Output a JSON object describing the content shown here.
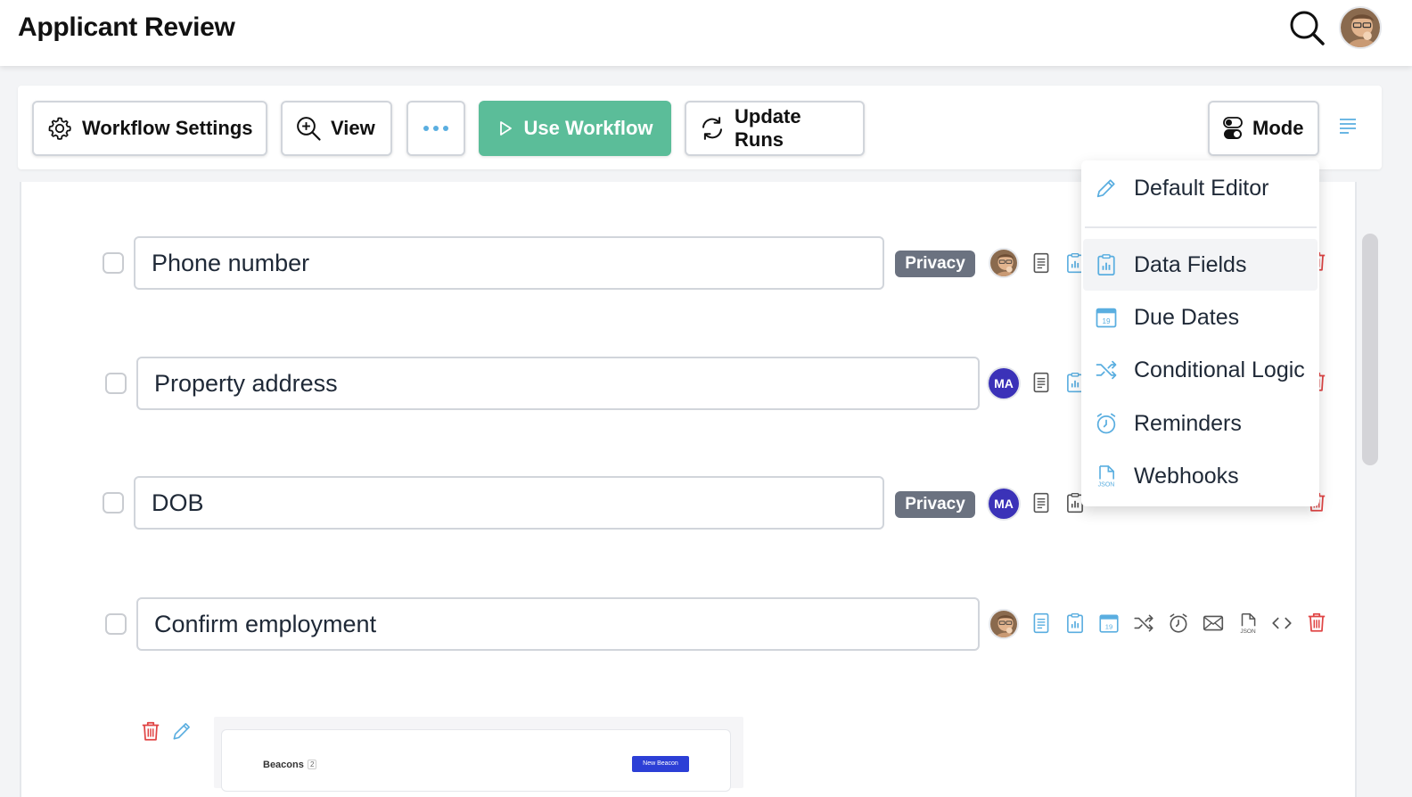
{
  "app": {
    "title": "Applicant Review"
  },
  "header": {
    "search_icon": "search-icon",
    "avatar": "user-avatar"
  },
  "toolbar": {
    "workflow_settings": "Workflow Settings",
    "view": "View",
    "use_workflow": "Use Workflow",
    "update_runs": "Update Runs",
    "mode": "Mode"
  },
  "colors": {
    "accent": "#5bbd99",
    "icon_blue": "#5aaee0",
    "danger": "#e04444",
    "privacy_badge": "#6b7280",
    "ma_badge": "#3b32b8"
  },
  "rows": [
    {
      "label": "Phone number",
      "privacy": "Privacy",
      "assignee": "avatar"
    },
    {
      "label": "Property address",
      "assignee": "MA"
    },
    {
      "label": "DOB",
      "privacy": "Privacy",
      "assignee": "MA"
    },
    {
      "label": "Confirm employment",
      "assignee": "avatar"
    }
  ],
  "mode_menu": {
    "items": [
      {
        "label": "Default Editor",
        "icon": "pencil-icon"
      },
      {
        "label": "Data Fields",
        "icon": "clipboard-chart-icon"
      },
      {
        "label": "Due Dates",
        "icon": "calendar-icon"
      },
      {
        "label": "Conditional Logic",
        "icon": "shuffle-icon"
      },
      {
        "label": "Reminders",
        "icon": "alarm-clock-icon"
      },
      {
        "label": "Webhooks",
        "icon": "json-file-icon"
      }
    ]
  },
  "preview": {
    "title": "Beacons",
    "count": "2",
    "button": "New Beacon"
  }
}
